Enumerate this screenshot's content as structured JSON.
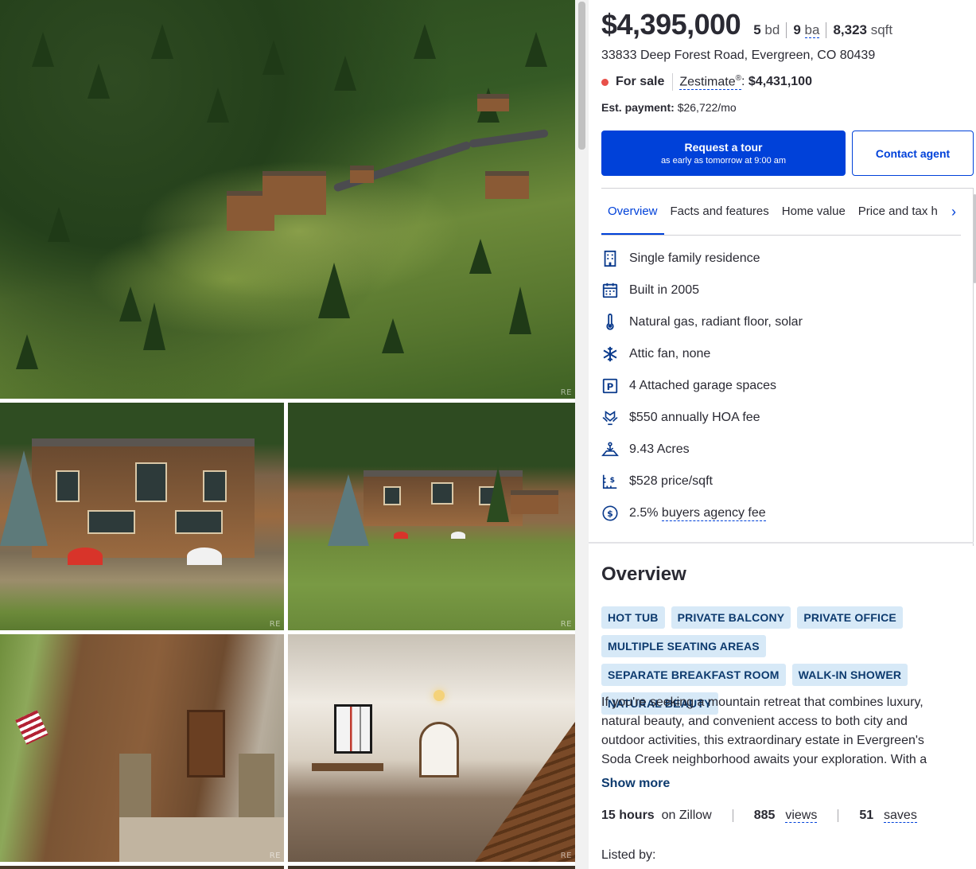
{
  "gallery": {
    "watermark": "RE",
    "photos": [
      "aerial-estate",
      "back-terrace",
      "back-lawn",
      "front-entry",
      "interior-hallway"
    ]
  },
  "listing": {
    "price": "$4,395,000",
    "beds_num": "5",
    "beds_unit": "bd",
    "baths_num": "9",
    "baths_unit": "ba",
    "sqft_num": "8,323",
    "sqft_unit": "sqft",
    "address": "33833 Deep Forest Road, Evergreen, CO 80439",
    "status": "For sale",
    "zestimate_label": "Zestimate",
    "zestimate_reg": "®",
    "zestimate_colon": ":",
    "zestimate_value": "$4,431,100",
    "est_payment_label": "Est. payment:",
    "est_payment_value": "$26,722/mo",
    "status_color": "#e8504a"
  },
  "actions": {
    "tour_label": "Request a tour",
    "tour_sub": "as early as tomorrow at 9:00 am",
    "contact_label": "Contact agent",
    "primary_color": "#0041d9"
  },
  "tabs": [
    "Overview",
    "Facts and features",
    "Home value",
    "Price and tax h"
  ],
  "facts": [
    {
      "icon": "building-icon",
      "text": "Single family residence"
    },
    {
      "icon": "calendar-icon",
      "text": "Built in 2005"
    },
    {
      "icon": "thermometer-icon",
      "text": "Natural gas, radiant floor, solar"
    },
    {
      "icon": "snowflake-icon",
      "text": "Attic fan, none"
    },
    {
      "icon": "parking-icon",
      "text": "4 Attached garage spaces"
    },
    {
      "icon": "hoa-hands-icon",
      "text": "$550 annually HOA fee"
    },
    {
      "icon": "lot-acres-icon",
      "text": "9.43 Acres"
    },
    {
      "icon": "price-per-sqft-icon",
      "text": "$528 price/sqft"
    },
    {
      "icon": "dollar-circle-icon",
      "text_pre": "2.5% ",
      "text_link": "buyers agency fee"
    }
  ],
  "overview": {
    "title": "Overview",
    "chips": [
      "HOT TUB",
      "PRIVATE BALCONY",
      "PRIVATE OFFICE",
      "MULTIPLE SEATING AREAS",
      "SEPARATE BREAKFAST ROOM",
      "WALK-IN SHOWER",
      "NATURAL BEAUTY"
    ],
    "description": "If you're seeking a mountain retreat that combines luxury, natural beauty, and convenient access to both city and outdoor activities, this extraordinary estate in Evergreen's Soda Creek neighborhood awaits your exploration. With a",
    "show_more": "Show more",
    "time_value": "15 hours",
    "time_suffix": "on Zillow",
    "views_value": "885",
    "views_label": "views",
    "saves_value": "51",
    "saves_label": "saves",
    "listed_by": "Listed by:"
  }
}
